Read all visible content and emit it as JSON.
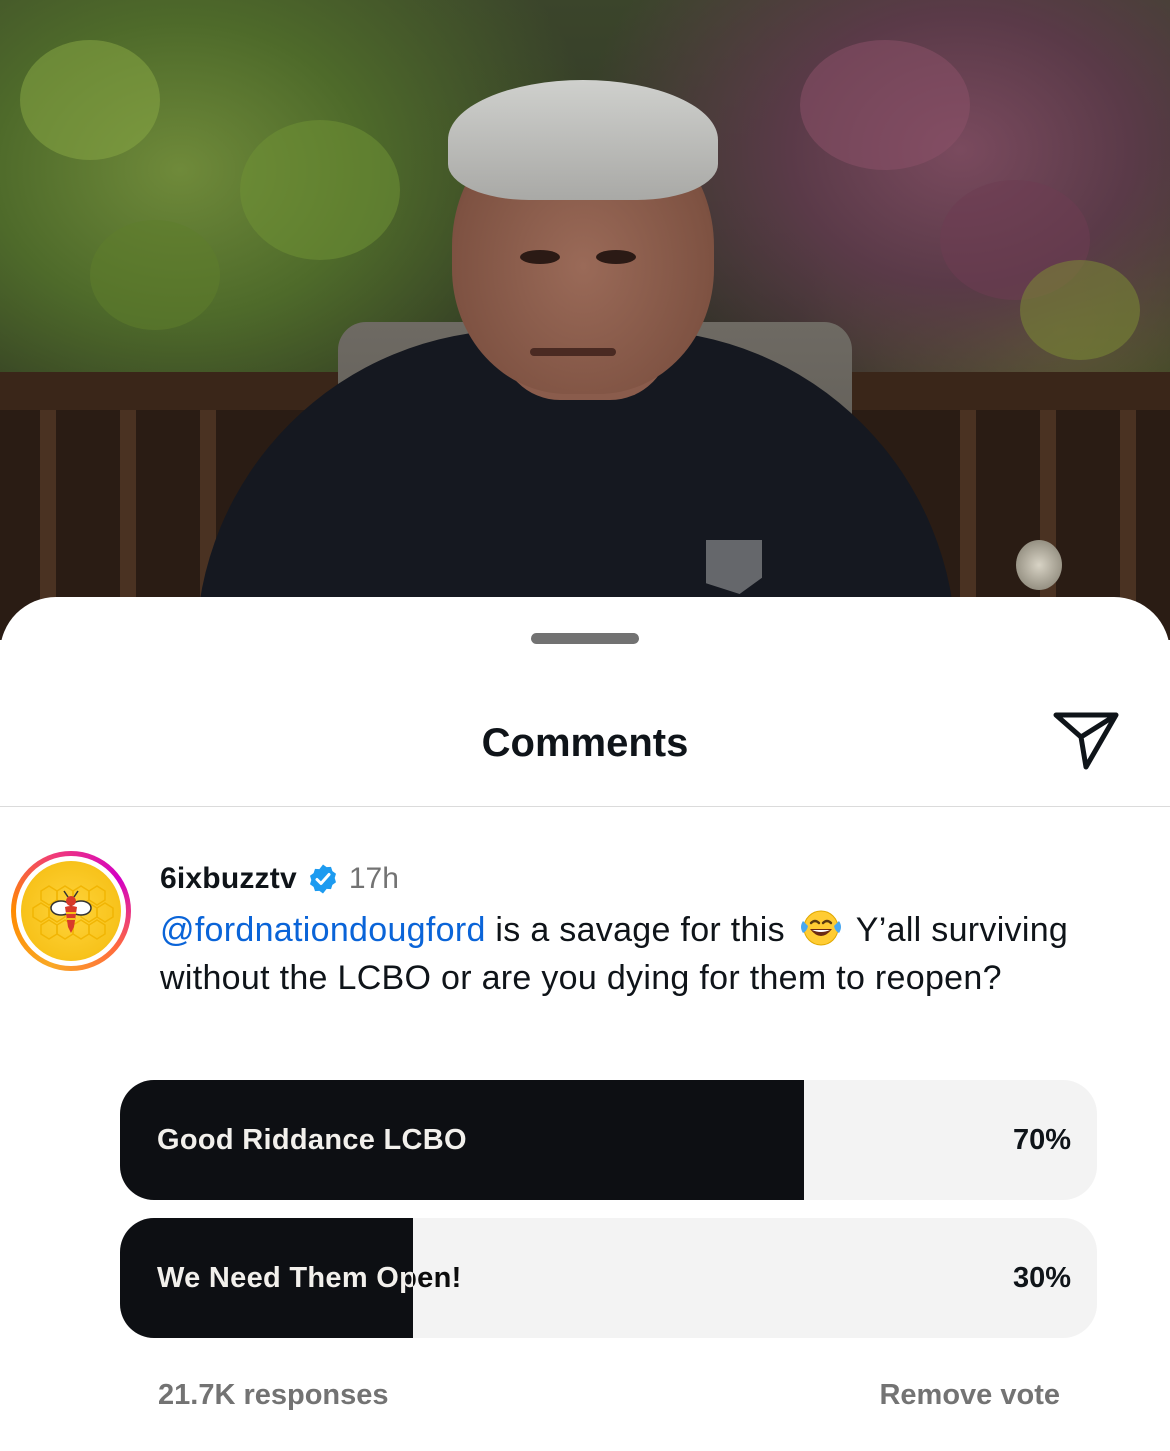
{
  "sheet": {
    "title": "Comments",
    "share_icon": "paper-plane-icon"
  },
  "comment": {
    "username": "6ixbuzztv",
    "verified_icon": "verified-badge-icon",
    "time": "17h",
    "mention": "@fordnationdougford",
    "text_part1": " is a savage for this ",
    "emoji_icon": "tears-of-joy-emoji-icon",
    "text_part2": " Y’all surviving without the LCBO or are you dying for them to reopen?"
  },
  "poll": {
    "options": [
      {
        "label": "Good Riddance LCBO",
        "percent_label": "70%",
        "percent": 70
      },
      {
        "label": "We Need Them Open!",
        "percent_label": "30%",
        "percent": 30
      }
    ],
    "responses": "21.7K responses",
    "remove_vote": "Remove vote"
  },
  "colors": {
    "mention": "#0a64d8",
    "verified": "#1d9bf0",
    "poll_fill": "#0d0f13",
    "poll_track": "#f3f3f3",
    "muted_text": "#737373"
  }
}
